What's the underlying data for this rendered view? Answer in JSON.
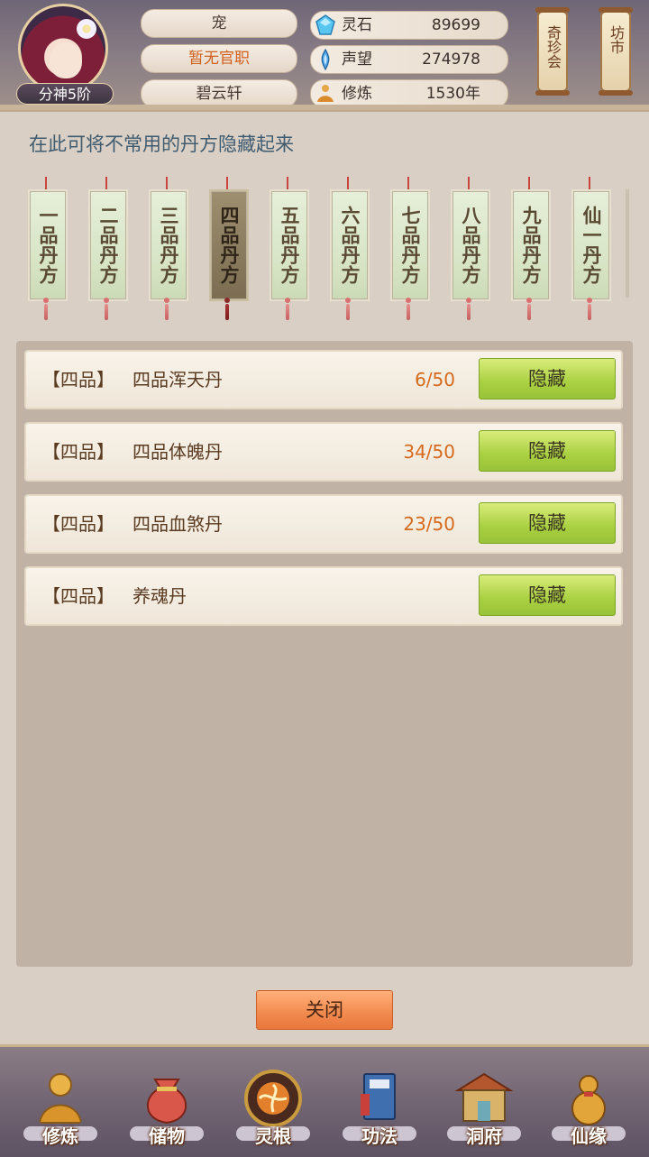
{
  "header": {
    "rank_label": "分神5阶",
    "name_plates": [
      "宠",
      "暂无官职",
      "碧云轩"
    ],
    "stats": [
      {
        "icon": "spirit-stone-icon",
        "label": "灵石",
        "value": "89699"
      },
      {
        "icon": "reputation-icon",
        "label": "声望",
        "value": "274978"
      },
      {
        "icon": "cultivation-icon",
        "label": "修炼",
        "value": "1530年"
      }
    ],
    "side_buttons": [
      "奇珍会",
      "坊市"
    ]
  },
  "hint": "在此可将不常用的丹方隐藏起来",
  "tabs": [
    "一品丹方",
    "二品丹方",
    "三品丹方",
    "四品丹方",
    "五品丹方",
    "六品丹方",
    "七品丹方",
    "八品丹方",
    "九品丹方",
    "仙一丹方"
  ],
  "active_tab_index": 3,
  "recipes": [
    {
      "grade": "【四品】",
      "name": "四品浑天丹",
      "count": "6/50",
      "button": "隐藏"
    },
    {
      "grade": "【四品】",
      "name": "四品体魄丹",
      "count": "34/50",
      "button": "隐藏"
    },
    {
      "grade": "【四品】",
      "name": "四品血煞丹",
      "count": "23/50",
      "button": "隐藏"
    },
    {
      "grade": "【四品】",
      "name": "养魂丹",
      "count": "",
      "button": "隐藏"
    }
  ],
  "close_label": "关闭",
  "nav": [
    {
      "label": "修炼",
      "icon": "meditating-figure-icon"
    },
    {
      "label": "储物",
      "icon": "treasure-bag-icon"
    },
    {
      "label": "灵根",
      "icon": "spirit-root-icon"
    },
    {
      "label": "功法",
      "icon": "technique-book-icon"
    },
    {
      "label": "洞府",
      "icon": "cave-mansion-icon"
    },
    {
      "label": "仙缘",
      "icon": "gourd-icon"
    }
  ],
  "colors": {
    "accent_orange": "#d56a1c",
    "button_green": "#a9d041",
    "close_orange": "#f28a4e",
    "hint_blue": "#3f5b70"
  }
}
